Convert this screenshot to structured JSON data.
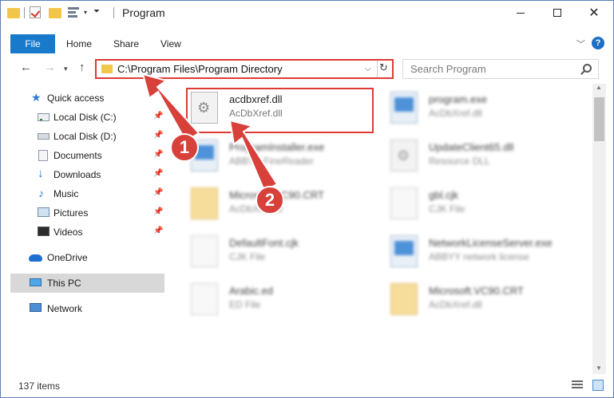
{
  "window": {
    "title": "Program"
  },
  "ribbon": {
    "tabs": [
      "File",
      "Home",
      "Share",
      "View"
    ],
    "help": "?"
  },
  "address": {
    "path": "C:\\Program Files\\Program Directory"
  },
  "search": {
    "placeholder": "Search Program"
  },
  "nav": [
    {
      "label": "Quick access",
      "icon": "star-icon"
    },
    {
      "label": "Local Disk (C:)",
      "icon": "drive-icon",
      "pinned": true
    },
    {
      "label": "Local Disk (D:)",
      "icon": "drive-icon",
      "pinned": true
    },
    {
      "label": "Documents",
      "icon": "documents-icon",
      "pinned": true
    },
    {
      "label": "Downloads",
      "icon": "download-icon",
      "pinned": true
    },
    {
      "label": "Music",
      "icon": "music-icon",
      "pinned": true
    },
    {
      "label": "Pictures",
      "icon": "pictures-icon",
      "pinned": true
    },
    {
      "label": "Videos",
      "icon": "videos-icon",
      "pinned": true
    },
    {
      "label": "OneDrive",
      "icon": "cloud-icon"
    },
    {
      "label": "This PC",
      "icon": "computer-icon",
      "selected": true
    },
    {
      "label": "Network",
      "icon": "network-icon"
    }
  ],
  "files": [
    {
      "name": "acdbxref.dll",
      "type": "AcDbXref.dll",
      "icon": "dll-icon"
    },
    {
      "name": "program.exe",
      "type": "AcDbXref.dll",
      "icon": "exe-icon"
    },
    {
      "name": "ProgramInstaller.exe",
      "type": "ABBYY FineReader",
      "icon": "exe-icon"
    },
    {
      "name": "UpdateClient65.dll",
      "type": "Resource DLL",
      "icon": "dll-icon"
    },
    {
      "name": "Microsoft.VC90.CRT",
      "type": "AcDbXref.dll",
      "icon": "zip-icon"
    },
    {
      "name": "gbl.cjk",
      "type": "CJK File",
      "icon": "file-icon"
    },
    {
      "name": "DefaultFont.cjk",
      "type": "CJK File",
      "icon": "file-icon"
    },
    {
      "name": "NetworkLicenseServer.exe",
      "type": "ABBYY network license",
      "icon": "exe-icon"
    },
    {
      "name": "Arabic.ed",
      "type": "ED File",
      "icon": "file-icon"
    },
    {
      "name": "Microsoft.VC90.CRT",
      "type": "AcDbXref.dll",
      "icon": "zip-icon"
    }
  ],
  "status": {
    "count": "137 items"
  },
  "markers": [
    "1",
    "2"
  ],
  "colors": {
    "accent": "#1979ca",
    "annotation": "#de3b35"
  }
}
